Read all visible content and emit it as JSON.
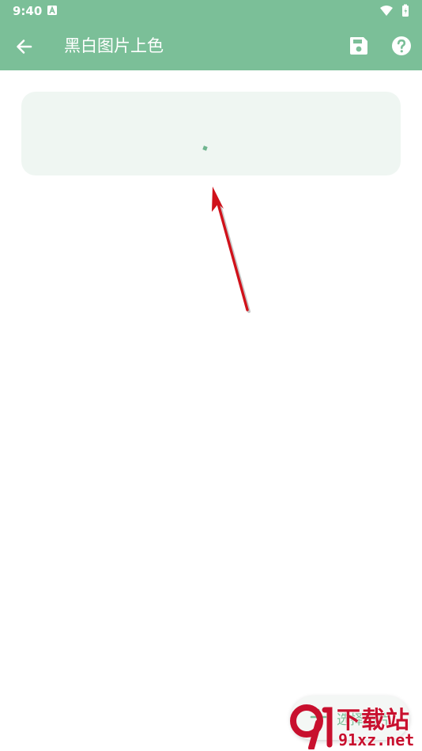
{
  "status_bar": {
    "time": "9:40",
    "notification_icon": "a-letter-icon",
    "wifi_icon": "wifi-icon",
    "battery_icon": "battery-charging-icon"
  },
  "app_bar": {
    "title": "黑白图片上色",
    "back_icon": "arrow-left-icon",
    "save_icon": "save-floppy-icon",
    "help_icon": "help-circle-icon"
  },
  "colors": {
    "primary": "#7bbf98",
    "card_background": "#eff6f2",
    "annotation_arrow": "#d0121b",
    "watermark": "#c8102e"
  },
  "image_card": {
    "state": "loading"
  },
  "fab": {
    "icon": "plus-icon",
    "label": "选择图片"
  },
  "watermark": {
    "brand_top": "下载站",
    "brand_bottom": "91xz.net"
  }
}
